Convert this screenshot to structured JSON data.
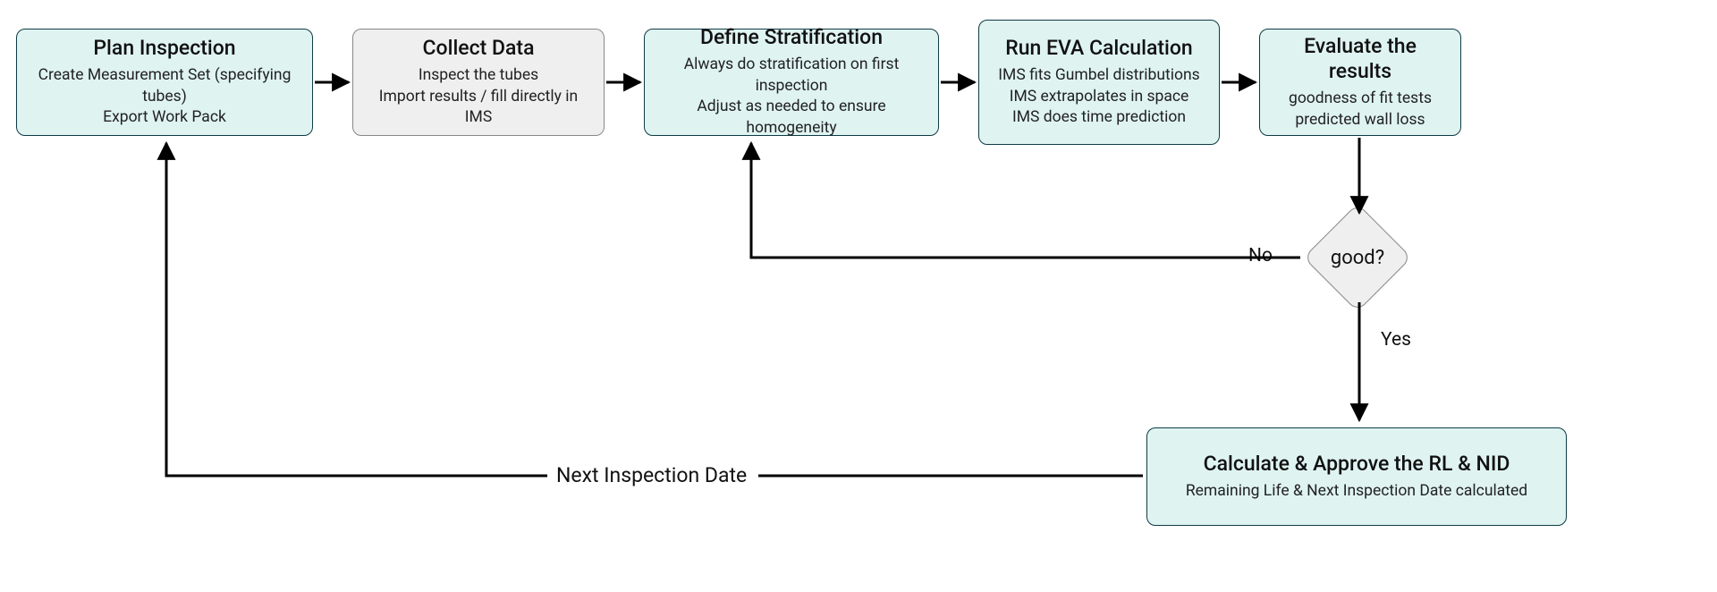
{
  "nodes": {
    "plan": {
      "title": "Plan Inspection",
      "lines": [
        "Create Measurement Set (specifying tubes)",
        "Export Work Pack"
      ]
    },
    "collect": {
      "title": "Collect Data",
      "lines": [
        "Inspect the tubes",
        "Import results / fill directly in IMS"
      ]
    },
    "stratify": {
      "title": "Define Stratification",
      "lines": [
        "Always do stratification on first inspection",
        "Adjust as needed to ensure homogeneity"
      ]
    },
    "eva": {
      "title": "Run EVA Calculation",
      "lines": [
        "IMS fits Gumbel distributions",
        "IMS extrapolates in space",
        "IMS does time prediction"
      ]
    },
    "evaluate": {
      "title": "Evaluate the results",
      "lines": [
        "goodness of fit tests",
        "predicted wall loss"
      ]
    },
    "calc": {
      "title": "Calculate & Approve the RL & NID",
      "lines": [
        "Remaining Life  & Next Inspection Date calculated"
      ]
    }
  },
  "decision": {
    "label": "good?",
    "yes": "Yes",
    "no": "No"
  },
  "edges": {
    "nextInspection": "Next Inspection Date"
  }
}
